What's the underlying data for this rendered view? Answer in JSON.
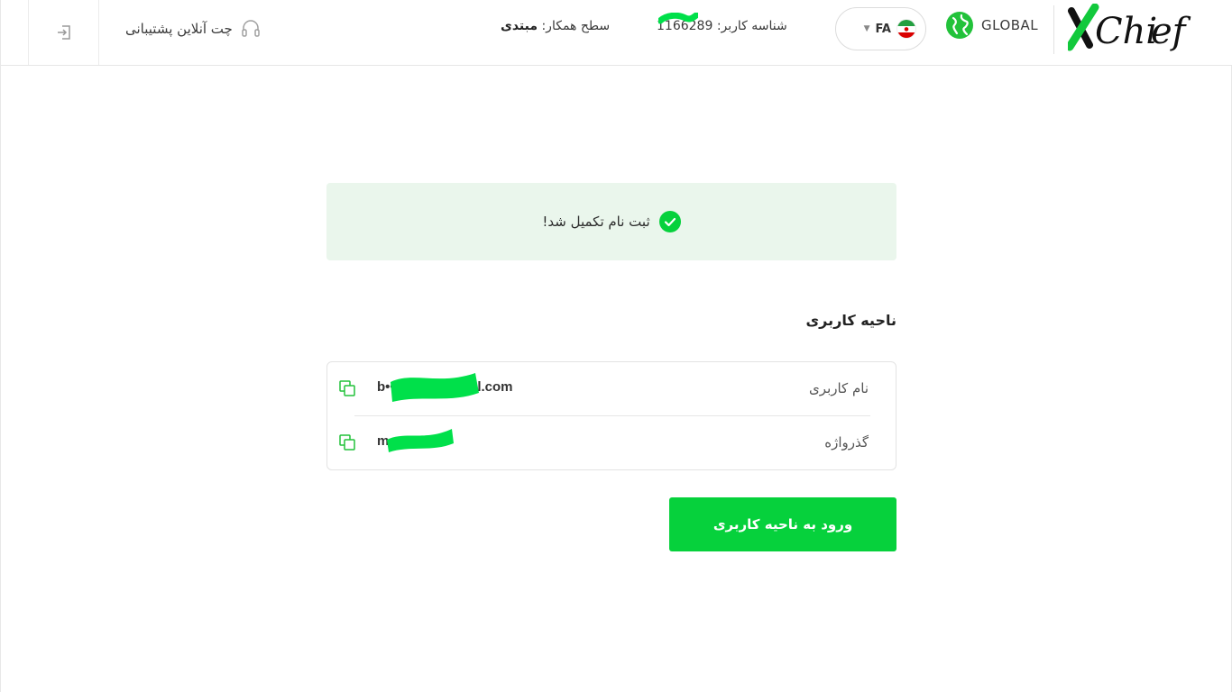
{
  "header": {
    "support_label": "چت آنلاین پشتیبانی",
    "partner_level_label": "سطح همکار:",
    "partner_level_value": "مبتدی",
    "user_id_label": "شناسه کاربر:",
    "user_id_value": "1166289",
    "language_code": "FA",
    "region_label": "GLOBAL",
    "logo_text": "XChief"
  },
  "banner": {
    "message": "ثبت نام تکمیل شد!"
  },
  "account_section": {
    "title": "ناحیه کاربری",
    "username_label": "نام کاربری",
    "username_value": "b••••••••••@gmail.com",
    "password_label": "گذرواژه",
    "password_value": "m•••••znd"
  },
  "actions": {
    "enter_label": "ورود به ناحیه کاربری"
  },
  "colors": {
    "accent_green": "#06d13c",
    "banner_bg": "#eaf6ec",
    "redaction_green": "#00e04a"
  },
  "icons": {
    "logout": "logout-icon",
    "support": "headset-icon",
    "language": "iran-flag-icon",
    "region": "globe-icon",
    "success": "check-circle-icon",
    "copy": "copy-icon"
  }
}
